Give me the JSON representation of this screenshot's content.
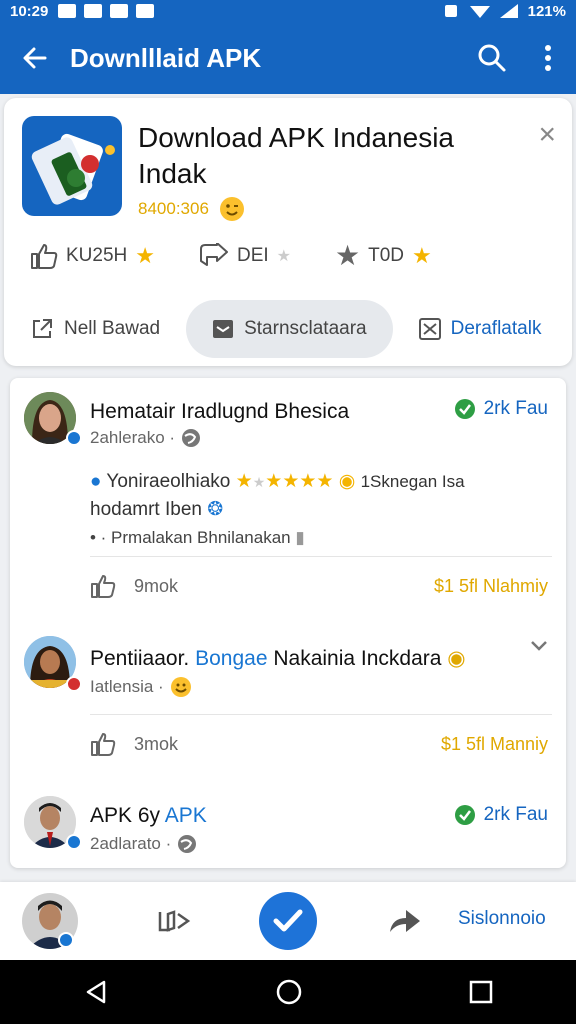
{
  "status_bar": {
    "time": "10:29",
    "battery": "121%"
  },
  "app_bar": {
    "title": "Downlllaid  APK"
  },
  "app_card": {
    "name": "Download APK Indanesia Indak",
    "sub": "8400:306 ",
    "stats": [
      {
        "label": "KU25H"
      },
      {
        "label": "DEI"
      },
      {
        "label": "T0D"
      }
    ],
    "tabs": [
      {
        "label": "Nell Bawad"
      },
      {
        "label": "Starnsclataara"
      },
      {
        "label": "Deraflatalk"
      }
    ]
  },
  "comments": [
    {
      "name": "Hematair Iradlugnd Bhesica",
      "meta": "2ahlerako ·",
      "right": "2rk Fau",
      "body_line1": "Yoniraeolhiako",
      "body_line1_tail": "1Sknegan Isa",
      "body_line2": "hodamrt Iben",
      "body_line3": "• · Prmalakan Bhnilanakan",
      "likes": "9mok",
      "tip": "$1 5fl Nlahmiy"
    },
    {
      "name_a": "Pentiiaaor.",
      "name_b": "Bongae",
      "name_c": "Nakainia Inckdara",
      "meta": "Iatlensia ·",
      "likes": "3mok",
      "tip": "$1 5fl Manniy"
    },
    {
      "name_a": "APK 6y",
      "name_b": "APK",
      "meta": "2adlarato ·",
      "right": "2rk Fau"
    }
  ],
  "bottom_bar": {
    "label": "Sislonnoio"
  }
}
